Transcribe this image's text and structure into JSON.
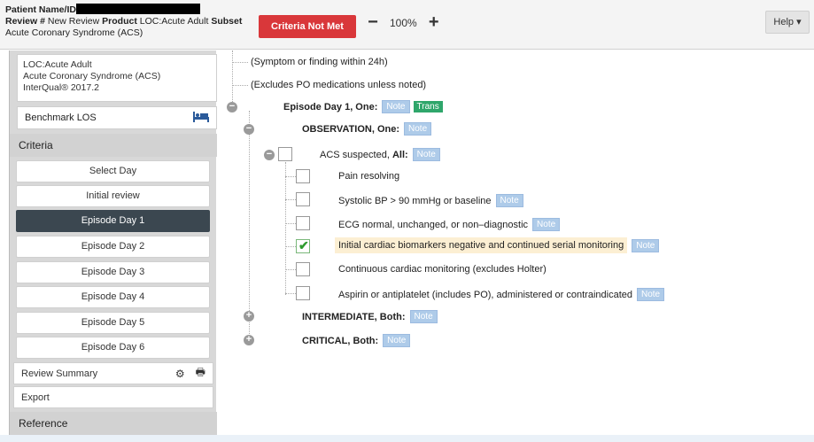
{
  "header": {
    "patient_label": "Patient Name/ID",
    "review_label": "Review #",
    "review_value": "New Review",
    "product_label": "Product",
    "product_value": "LOC:Acute Adult",
    "subset_label": "Subset",
    "subset_value": "Acute Coronary Syndrome (ACS)",
    "criteria_button": "Criteria Not Met",
    "zoom_minus": "−",
    "zoom_value": "100%",
    "zoom_plus": "+",
    "help_label": "Help ▾"
  },
  "sidebar": {
    "loc_line1": "LOC:Acute Adult",
    "loc_line2": "Acute Coronary Syndrome (ACS)",
    "loc_line3": "InterQual® 2017.2",
    "benchmark_label": "Benchmark LOS",
    "criteria_header": "Criteria",
    "days": [
      "Select Day",
      "Initial review",
      "Episode Day 1",
      "Episode Day 2",
      "Episode Day 3",
      "Episode Day 4",
      "Episode Day 5",
      "Episode Day 6"
    ],
    "active_day": "Episode Day 1",
    "review_summary": "Review Summary",
    "export": "Export",
    "reference_header": "Reference"
  },
  "tree": {
    "note_label": "Note",
    "trans_label": "Trans",
    "legend1": "(Symptom or finding within 24h)",
    "legend2": "(Excludes PO medications unless noted)",
    "episode": {
      "title": "Episode Day 1, One:"
    },
    "observation": {
      "title": "OBSERVATION, One:"
    },
    "acs": {
      "prefix": "ACS suspected,",
      "bold": "All:"
    },
    "items": [
      {
        "text": "Pain resolving",
        "checked": false,
        "note": false
      },
      {
        "text": "Systolic BP > 90 mmHg or baseline",
        "checked": false,
        "note": true
      },
      {
        "text": "ECG normal, unchanged, or non–diagnostic",
        "checked": false,
        "note": true
      },
      {
        "text": "Initial cardiac biomarkers negative and continued serial monitoring",
        "checked": true,
        "note": true
      },
      {
        "text": "Continuous cardiac monitoring (excludes Holter)",
        "checked": false,
        "note": false
      },
      {
        "text": "Aspirin or antiplatelet (includes PO), administered or contraindicated",
        "checked": false,
        "note": true
      }
    ],
    "intermediate": {
      "title": "INTERMEDIATE, Both:"
    },
    "critical": {
      "title": "CRITICAL, Both:"
    }
  }
}
